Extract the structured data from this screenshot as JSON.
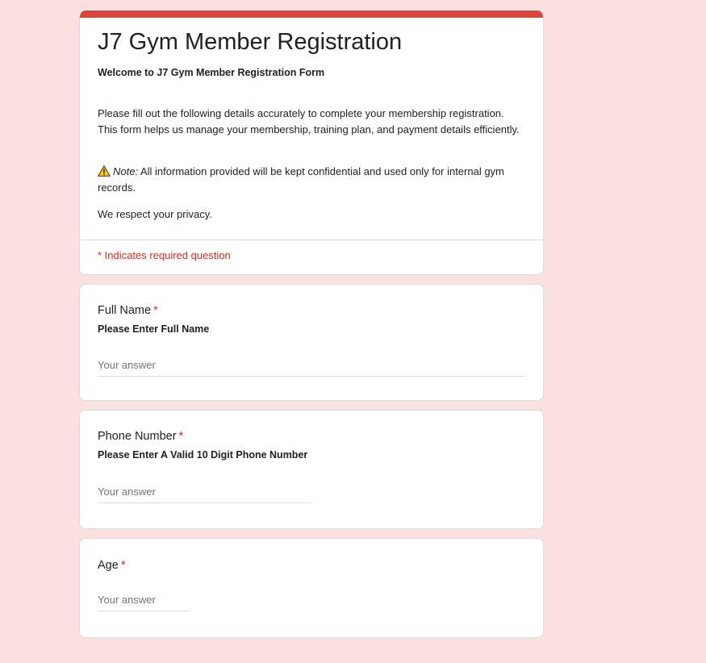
{
  "header": {
    "title": "J7 Gym Member Registration",
    "welcome": "Welcome to J7 Gym Member Registration Form",
    "description": "Please fill out the following details accurately to complete your membership registration. This form helps us manage your membership, training plan, and payment details efficiently.",
    "note_label": "Note:",
    "note_text": " All information provided will be kept confidential and used only for internal gym records.",
    "privacy": "We respect your privacy.",
    "required_note": "* Indicates required question",
    "accent_color": "#db4437",
    "background_color": "#fae0df"
  },
  "questions": [
    {
      "title": "Full Name",
      "required_mark": "*",
      "help": "Please Enter Full Name",
      "placeholder": "Your answer"
    },
    {
      "title": "Phone Number",
      "required_mark": "*",
      "help": "Please Enter A Valid 10 Digit Phone Number",
      "placeholder": "Your answer"
    },
    {
      "title": "Age",
      "required_mark": "*",
      "placeholder": "Your answer"
    }
  ]
}
